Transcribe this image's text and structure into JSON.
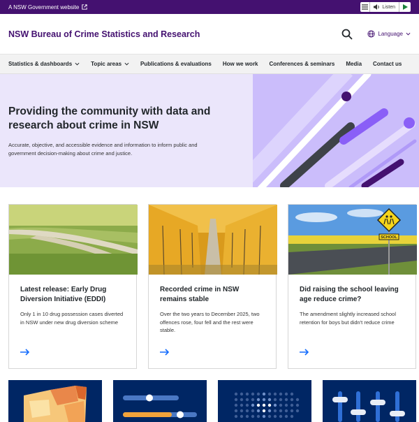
{
  "masthead": {
    "gov_link": "A NSW Government website",
    "listen_label": "Listen"
  },
  "header": {
    "site_title": "NSW Bureau of Crime Statistics and Research",
    "language_label": "Language"
  },
  "nav": {
    "items": [
      {
        "label": "Statistics & dashboards",
        "dropdown": true
      },
      {
        "label": "Topic areas",
        "dropdown": true
      },
      {
        "label": "Publications & evaluations",
        "dropdown": false
      },
      {
        "label": "How we work",
        "dropdown": false
      },
      {
        "label": "Conferences & seminars",
        "dropdown": false
      },
      {
        "label": "Media",
        "dropdown": false
      },
      {
        "label": "Contact us",
        "dropdown": false
      }
    ]
  },
  "hero": {
    "title": "Providing the community with data and research about crime in NSW",
    "subtitle": "Accurate, objective, and accessible evidence and information to inform public and government decision-making about crime and justice."
  },
  "cards": [
    {
      "title": "Latest release: Early Drug Diversion Initiative (EDDI)",
      "description": "Only 1 in 10 drug possession cases diverted in NSW under new drug diversion scheme"
    },
    {
      "title": "Recorded crime in NSW remains stable",
      "description": "Over the two years to December 2025, two offences rose, four fell and the rest were stable."
    },
    {
      "title": "Did raising the school leaving age reduce crime?",
      "description": "The amendment slightly increased school retention for boys but didn't reduce crime",
      "sign_text": "SCHOOL"
    }
  ],
  "colors": {
    "masthead": "#441170",
    "brand": "#441170",
    "hero_bg": "#ebe6fb",
    "link": "#146cfd",
    "tile_bg": "#002664"
  }
}
